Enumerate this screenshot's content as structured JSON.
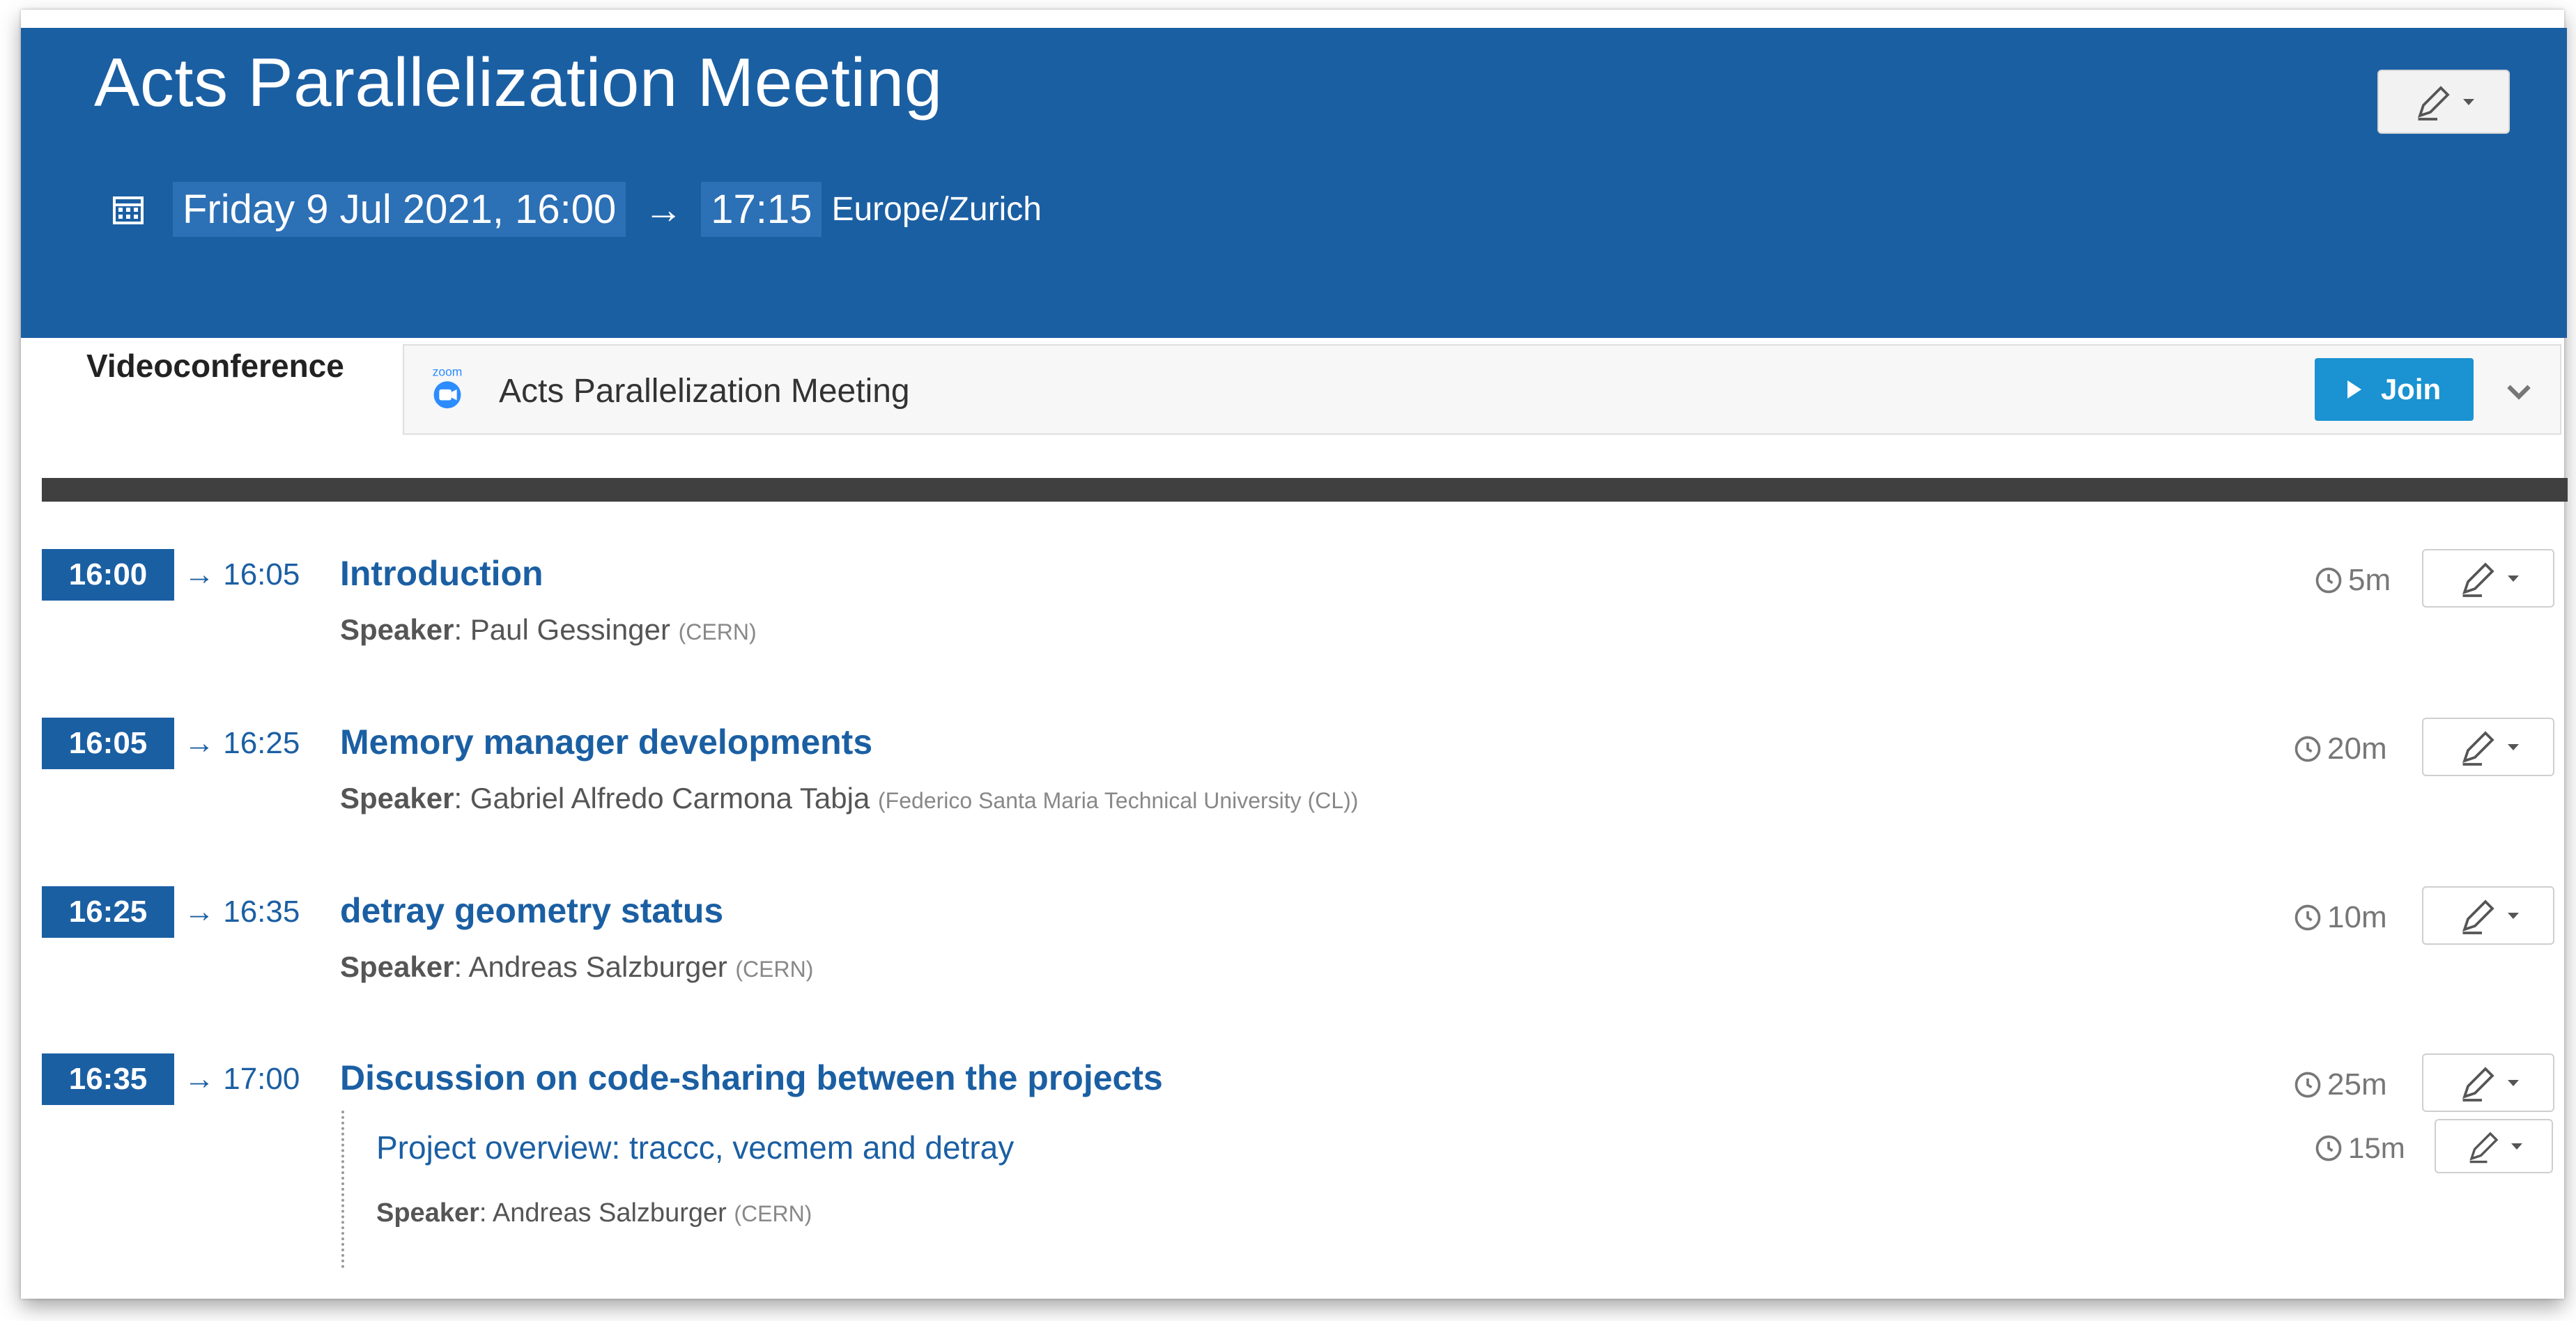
{
  "event": {
    "title": "Acts Parallelization Meeting",
    "date": "Friday 9 Jul 2021, 16:00",
    "arrow": "→",
    "end": "17:15",
    "timezone": "Europe/Zurich"
  },
  "videoconference": {
    "label": "Videoconference",
    "provider_icon": "zoom-icon",
    "room_name": "Acts Parallelization Meeting",
    "join_label": "Join"
  },
  "timetable": [
    {
      "start": "16:00",
      "end": "→ 16:05",
      "title": "Introduction",
      "speaker_label": "Speaker",
      "speaker": "Paul Gessinger",
      "affiliation": "(CERN)",
      "duration": "5m"
    },
    {
      "start": "16:05",
      "end": "→ 16:25",
      "title": "Memory manager developments",
      "speaker_label": "Speaker",
      "speaker": "Gabriel Alfredo Carmona Tabja",
      "affiliation": "(Federico Santa Maria Technical University (CL))",
      "duration": "20m"
    },
    {
      "start": "16:25",
      "end": "→ 16:35",
      "title": "detray geometry status",
      "speaker_label": "Speaker",
      "speaker": "Andreas Salzburger",
      "affiliation": "(CERN)",
      "duration": "10m"
    },
    {
      "start": "16:35",
      "end": "→ 17:00",
      "title": "Discussion on code-sharing between the projects",
      "duration": "25m",
      "sub": {
        "title": "Project overview: traccc, vecmem and detray",
        "speaker_label": "Speaker",
        "speaker": "Andreas Salzburger",
        "affiliation": "(CERN)",
        "duration": "15m"
      }
    }
  ],
  "colors": {
    "header": "#1b5fa3",
    "join": "#1b92d1",
    "divider": "#404040"
  }
}
